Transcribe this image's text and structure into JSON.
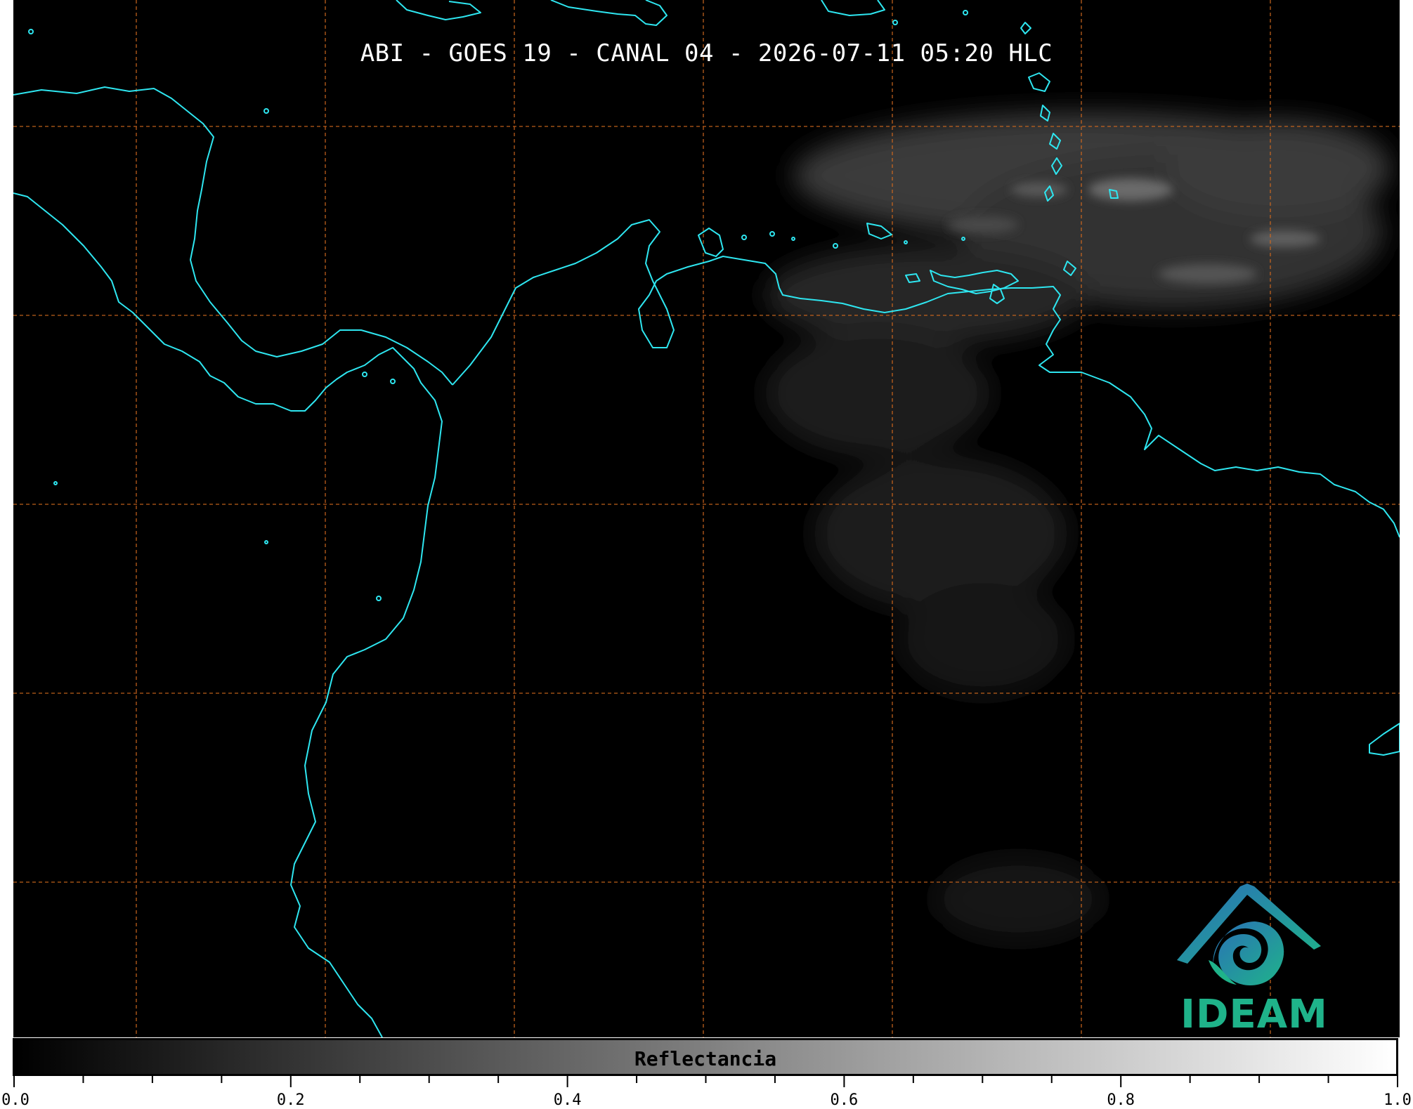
{
  "title": "ABI - GOES 19 - CANAL 04 - 2026-07-11 05:20 HLC",
  "colorbar": {
    "label": "Reflectancia",
    "min": 0.0,
    "max": 1.0,
    "ticks": [
      "0.0",
      "0.2",
      "0.4",
      "0.6",
      "0.8",
      "1.0"
    ],
    "gradient_start": "#000000",
    "gradient_end": "#ffffff"
  },
  "logo": {
    "text": "IDEAM",
    "color": "#1fb38a",
    "accent": "#2a6fb8"
  },
  "map": {
    "background": "#000000",
    "coastline_color": "#2ee6f0",
    "grid_color": "#d2691e",
    "grid_style": "dashed"
  }
}
